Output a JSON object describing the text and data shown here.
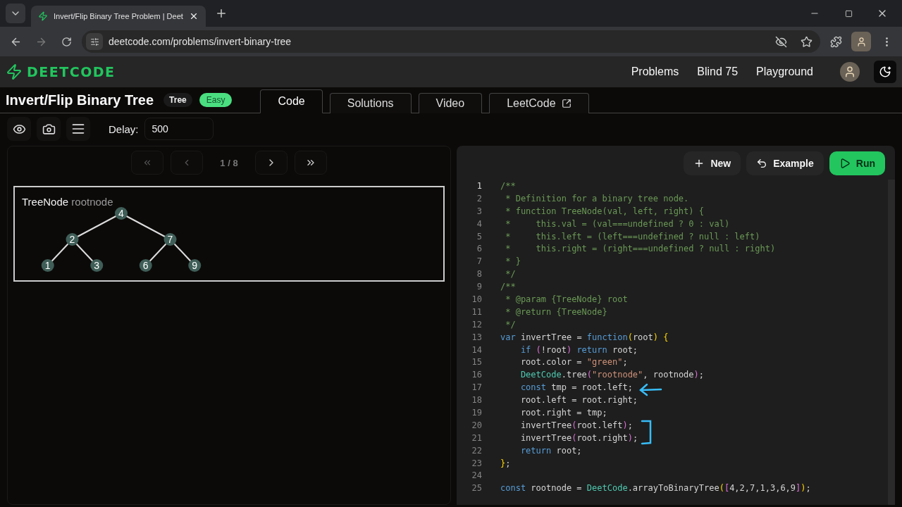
{
  "browser": {
    "tab_title": "Invert/Flip Binary Tree Problem | Deet",
    "url": "deetcode.com/problems/invert-binary-tree"
  },
  "site": {
    "logo": "DEETCODE",
    "nav": [
      "Problems",
      "Blind 75",
      "Playground"
    ]
  },
  "problem": {
    "title": "Invert/Flip Binary Tree",
    "tag": "Tree",
    "difficulty": "Easy"
  },
  "tabs": [
    {
      "label": "Code",
      "selected": true,
      "external": false
    },
    {
      "label": "Solutions",
      "selected": false,
      "external": false
    },
    {
      "label": "Video",
      "selected": false,
      "external": false
    },
    {
      "label": "LeetCode",
      "selected": false,
      "external": true
    }
  ],
  "toolbar": {
    "delay_label": "Delay:",
    "delay_value": "500"
  },
  "stepper": {
    "position": "1 / 8"
  },
  "visual": {
    "type": "TreeNode",
    "name": "rootnode",
    "tree": {
      "value": "4",
      "children": [
        {
          "value": "2",
          "children": [
            {
              "value": "1"
            },
            {
              "value": "3"
            }
          ]
        },
        {
          "value": "7",
          "children": [
            {
              "value": "6"
            },
            {
              "value": "9"
            }
          ]
        }
      ]
    }
  },
  "editor_buttons": [
    {
      "kind": "new",
      "label": "New"
    },
    {
      "kind": "example",
      "label": "Example"
    },
    {
      "kind": "run",
      "label": "Run"
    }
  ],
  "code": [
    {
      "n": "1",
      "tokens": [
        {
          "kind": "comment",
          "text": "/**"
        }
      ]
    },
    {
      "n": "2",
      "tokens": [
        {
          "kind": "comment",
          "text": " * Definition for a binary tree node."
        }
      ]
    },
    {
      "n": "3",
      "tokens": [
        {
          "kind": "comment",
          "text": " * function TreeNode(val, left, right) {"
        }
      ]
    },
    {
      "n": "4",
      "tokens": [
        {
          "kind": "comment",
          "text": " *     this.val = (val===undefined ? 0 : val)"
        }
      ]
    },
    {
      "n": "5",
      "tokens": [
        {
          "kind": "comment",
          "text": " *     this.left = (left===undefined ? null : left)"
        }
      ]
    },
    {
      "n": "6",
      "tokens": [
        {
          "kind": "comment",
          "text": " *     this.right = (right===undefined ? null : right)"
        }
      ]
    },
    {
      "n": "7",
      "tokens": [
        {
          "kind": "comment",
          "text": " * }"
        }
      ]
    },
    {
      "n": "8",
      "tokens": [
        {
          "kind": "comment",
          "text": " */"
        }
      ]
    },
    {
      "n": "9",
      "tokens": [
        {
          "kind": "comment",
          "text": "/**"
        }
      ]
    },
    {
      "n": "10",
      "tokens": [
        {
          "kind": "comment",
          "text": " * @param {TreeNode} root"
        }
      ]
    },
    {
      "n": "11",
      "tokens": [
        {
          "kind": "comment",
          "text": " * @return {TreeNode}"
        }
      ]
    },
    {
      "n": "12",
      "tokens": [
        {
          "kind": "comment",
          "text": " */"
        }
      ]
    },
    {
      "n": "13",
      "tokens": [
        {
          "kind": "keyword",
          "text": "var"
        },
        {
          "kind": "plain",
          "text": " invertTree = "
        },
        {
          "kind": "keyword",
          "text": "function"
        },
        {
          "kind": "bracket",
          "text": "("
        },
        {
          "kind": "plain",
          "text": "root"
        },
        {
          "kind": "bracket",
          "text": ")"
        },
        {
          "kind": "bracket",
          "text": " {"
        }
      ]
    },
    {
      "n": "14",
      "tokens": [
        {
          "kind": "keyword",
          "text": "    if"
        },
        {
          "kind": "bracket2",
          "text": " ("
        },
        {
          "kind": "plain",
          "text": "!root"
        },
        {
          "kind": "bracket2",
          "text": ")"
        },
        {
          "kind": "keyword",
          "text": " return"
        },
        {
          "kind": "plain",
          "text": " root;"
        }
      ]
    },
    {
      "n": "15",
      "tokens": [
        {
          "kind": "plain",
          "text": "    root.color = "
        },
        {
          "kind": "string",
          "text": "\"green\""
        },
        {
          "kind": "plain",
          "text": ";"
        }
      ]
    },
    {
      "n": "16",
      "tokens": [
        {
          "kind": "class",
          "text": "    DeetCode"
        },
        {
          "kind": "plain",
          "text": ".tree"
        },
        {
          "kind": "bracket2",
          "text": "("
        },
        {
          "kind": "string",
          "text": "\"rootnode\""
        },
        {
          "kind": "plain",
          "text": ", rootnode"
        },
        {
          "kind": "bracket2",
          "text": ")"
        },
        {
          "kind": "plain",
          "text": ";"
        }
      ]
    },
    {
      "n": "17",
      "tokens": [
        {
          "kind": "keyword",
          "text": "    const"
        },
        {
          "kind": "plain",
          "text": " tmp = root.left;"
        }
      ]
    },
    {
      "n": "18",
      "tokens": [
        {
          "kind": "plain",
          "text": "    root.left = root.right;"
        }
      ]
    },
    {
      "n": "19",
      "tokens": [
        {
          "kind": "plain",
          "text": "    root.right = tmp;"
        }
      ]
    },
    {
      "n": "20",
      "tokens": [
        {
          "kind": "plain",
          "text": "    invertTree"
        },
        {
          "kind": "bracket2",
          "text": "("
        },
        {
          "kind": "plain",
          "text": "root.left"
        },
        {
          "kind": "bracket2",
          "text": ")"
        },
        {
          "kind": "plain",
          "text": ";"
        }
      ]
    },
    {
      "n": "21",
      "tokens": [
        {
          "kind": "plain",
          "text": "    invertTree"
        },
        {
          "kind": "bracket2",
          "text": "("
        },
        {
          "kind": "plain",
          "text": "root.right"
        },
        {
          "kind": "bracket2",
          "text": ")"
        },
        {
          "kind": "plain",
          "text": ";"
        }
      ]
    },
    {
      "n": "22",
      "tokens": [
        {
          "kind": "keyword",
          "text": "    return"
        },
        {
          "kind": "plain",
          "text": " root;"
        }
      ]
    },
    {
      "n": "23",
      "tokens": [
        {
          "kind": "bracket",
          "text": "}"
        },
        {
          "kind": "plain",
          "text": ";"
        }
      ]
    },
    {
      "n": "24"
    },
    {
      "n": "25",
      "tokens": [
        {
          "kind": "keyword",
          "text": "const"
        },
        {
          "kind": "plain",
          "text": " rootnode = "
        },
        {
          "kind": "class",
          "text": "DeetCode"
        },
        {
          "kind": "plain",
          "text": ".arrayToBinaryTree"
        },
        {
          "kind": "bracket",
          "text": "("
        },
        {
          "kind": "bracket2",
          "text": "["
        },
        {
          "kind": "plain",
          "text": "4,2,7,1,3,6,9"
        },
        {
          "kind": "bracket2",
          "text": "]"
        },
        {
          "kind": "bracket",
          "text": ")"
        },
        {
          "kind": "plain",
          "text": ";"
        }
      ]
    }
  ]
}
